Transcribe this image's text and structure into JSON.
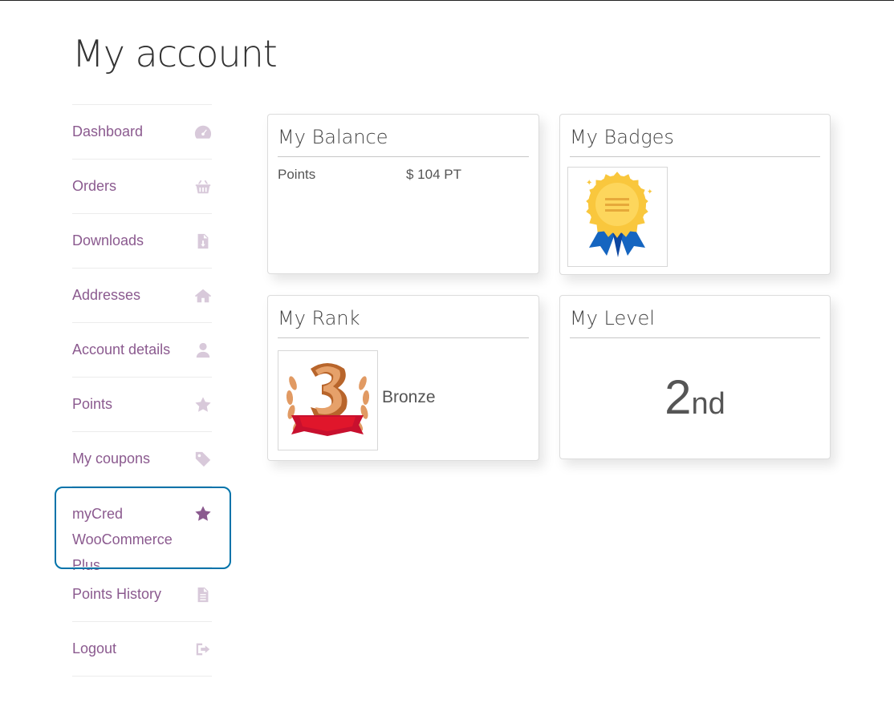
{
  "page": {
    "title": "My account"
  },
  "nav": {
    "items": [
      {
        "label": "Dashboard",
        "icon": "dashboard-icon"
      },
      {
        "label": "Orders",
        "icon": "basket-icon"
      },
      {
        "label": "Downloads",
        "icon": "file-download-icon"
      },
      {
        "label": "Addresses",
        "icon": "home-icon"
      },
      {
        "label": "Account details",
        "icon": "user-icon"
      },
      {
        "label": "Points",
        "icon": "star-icon"
      },
      {
        "label": "My coupons",
        "icon": "tag-icon"
      },
      {
        "label": "myCred WooCommerce Plus",
        "icon": "star-icon",
        "active": true
      },
      {
        "label": "Points History",
        "icon": "document-icon"
      },
      {
        "label": "Logout",
        "icon": "sign-out-icon"
      }
    ]
  },
  "balance": {
    "title": "My Balance",
    "label": "Points",
    "value": "$ 104 PT"
  },
  "badges": {
    "title": "My Badges",
    "badge_icon": "award-ribbon-icon"
  },
  "rank": {
    "title": "My Rank",
    "name": "Bronze",
    "rank_icon": "bronze-rank-3-icon"
  },
  "level": {
    "title": "My Level",
    "number": "2",
    "suffix": "nd"
  },
  "colors": {
    "link": "#8b5a8f",
    "icon": "#d8c9da",
    "focus": "#0073aa"
  }
}
